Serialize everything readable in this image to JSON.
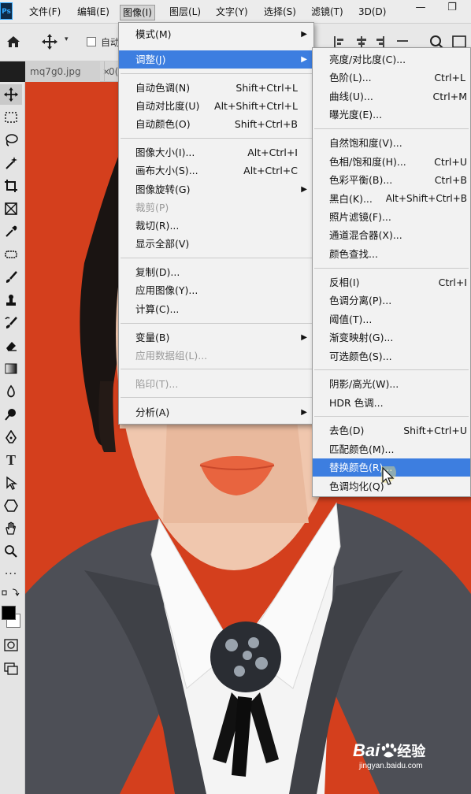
{
  "app": {
    "logo": "Ps"
  },
  "menubar": [
    {
      "label": "文件(F)"
    },
    {
      "label": "编辑(E)"
    },
    {
      "label": "图像(I)"
    },
    {
      "label": "图层(L)"
    },
    {
      "label": "文字(Y)"
    },
    {
      "label": "选择(S)"
    },
    {
      "label": "滤镜(T)"
    },
    {
      "label": "3D(D)"
    }
  ],
  "window_controls": {
    "minimize": "—",
    "restore": "❐"
  },
  "options": {
    "auto_label": "自动"
  },
  "tabs": [
    {
      "label": "mq7g0.jpg"
    },
    {
      "label": "×"
    },
    {
      "label": "0("
    }
  ],
  "image_menu": [
    {
      "label": "模式(M)",
      "shortcut": "",
      "submenu": true
    },
    {
      "label": "调整(J)",
      "shortcut": "",
      "submenu": true,
      "highlighted": true
    },
    {
      "label": "自动色调(N)",
      "shortcut": "Shift+Ctrl+L"
    },
    {
      "label": "自动对比度(U)",
      "shortcut": "Alt+Shift+Ctrl+L"
    },
    {
      "label": "自动颜色(O)",
      "shortcut": "Shift+Ctrl+B"
    },
    {
      "label": "图像大小(I)...",
      "shortcut": "Alt+Ctrl+I"
    },
    {
      "label": "画布大小(S)...",
      "shortcut": "Alt+Ctrl+C"
    },
    {
      "label": "图像旋转(G)",
      "shortcut": "",
      "submenu": true
    },
    {
      "label": "裁剪(P)",
      "shortcut": "",
      "disabled": true
    },
    {
      "label": "裁切(R)...",
      "shortcut": ""
    },
    {
      "label": "显示全部(V)",
      "shortcut": ""
    },
    {
      "label": "复制(D)...",
      "shortcut": ""
    },
    {
      "label": "应用图像(Y)...",
      "shortcut": ""
    },
    {
      "label": "计算(C)...",
      "shortcut": ""
    },
    {
      "label": "变量(B)",
      "shortcut": "",
      "submenu": true
    },
    {
      "label": "应用数据组(L)...",
      "shortcut": "",
      "disabled": true
    },
    {
      "label": "陷印(T)...",
      "shortcut": "",
      "disabled": true
    },
    {
      "label": "分析(A)",
      "shortcut": "",
      "submenu": true
    }
  ],
  "adjust_menu": [
    {
      "label": "亮度/对比度(C)...",
      "shortcut": ""
    },
    {
      "label": "色阶(L)...",
      "shortcut": "Ctrl+L"
    },
    {
      "label": "曲线(U)...",
      "shortcut": "Ctrl+M"
    },
    {
      "label": "曝光度(E)...",
      "shortcut": ""
    },
    {
      "label": "自然饱和度(V)...",
      "shortcut": ""
    },
    {
      "label": "色相/饱和度(H)...",
      "shortcut": "Ctrl+U"
    },
    {
      "label": "色彩平衡(B)...",
      "shortcut": "Ctrl+B"
    },
    {
      "label": "黑白(K)...",
      "shortcut": "Alt+Shift+Ctrl+B"
    },
    {
      "label": "照片滤镜(F)...",
      "shortcut": ""
    },
    {
      "label": "通道混合器(X)...",
      "shortcut": ""
    },
    {
      "label": "颜色查找...",
      "shortcut": ""
    },
    {
      "label": "反相(I)",
      "shortcut": "Ctrl+I"
    },
    {
      "label": "色调分离(P)...",
      "shortcut": ""
    },
    {
      "label": "阈值(T)...",
      "shortcut": ""
    },
    {
      "label": "渐变映射(G)...",
      "shortcut": ""
    },
    {
      "label": "可选颜色(S)...",
      "shortcut": ""
    },
    {
      "label": "阴影/高光(W)...",
      "shortcut": ""
    },
    {
      "label": "HDR 色调...",
      "shortcut": ""
    },
    {
      "label": "去色(D)",
      "shortcut": "Shift+Ctrl+U"
    },
    {
      "label": "匹配颜色(M)...",
      "shortcut": ""
    },
    {
      "label": "替换颜色(R)...",
      "shortcut": "",
      "highlighted": true
    },
    {
      "label": "色调均化(Q)",
      "shortcut": ""
    }
  ],
  "watermark": {
    "brand": "Bai",
    "brand2": "经验",
    "url": "jingyan.baidu.com"
  },
  "colors": {
    "accent": "#3d7ee0",
    "background": "#d43f1d"
  }
}
